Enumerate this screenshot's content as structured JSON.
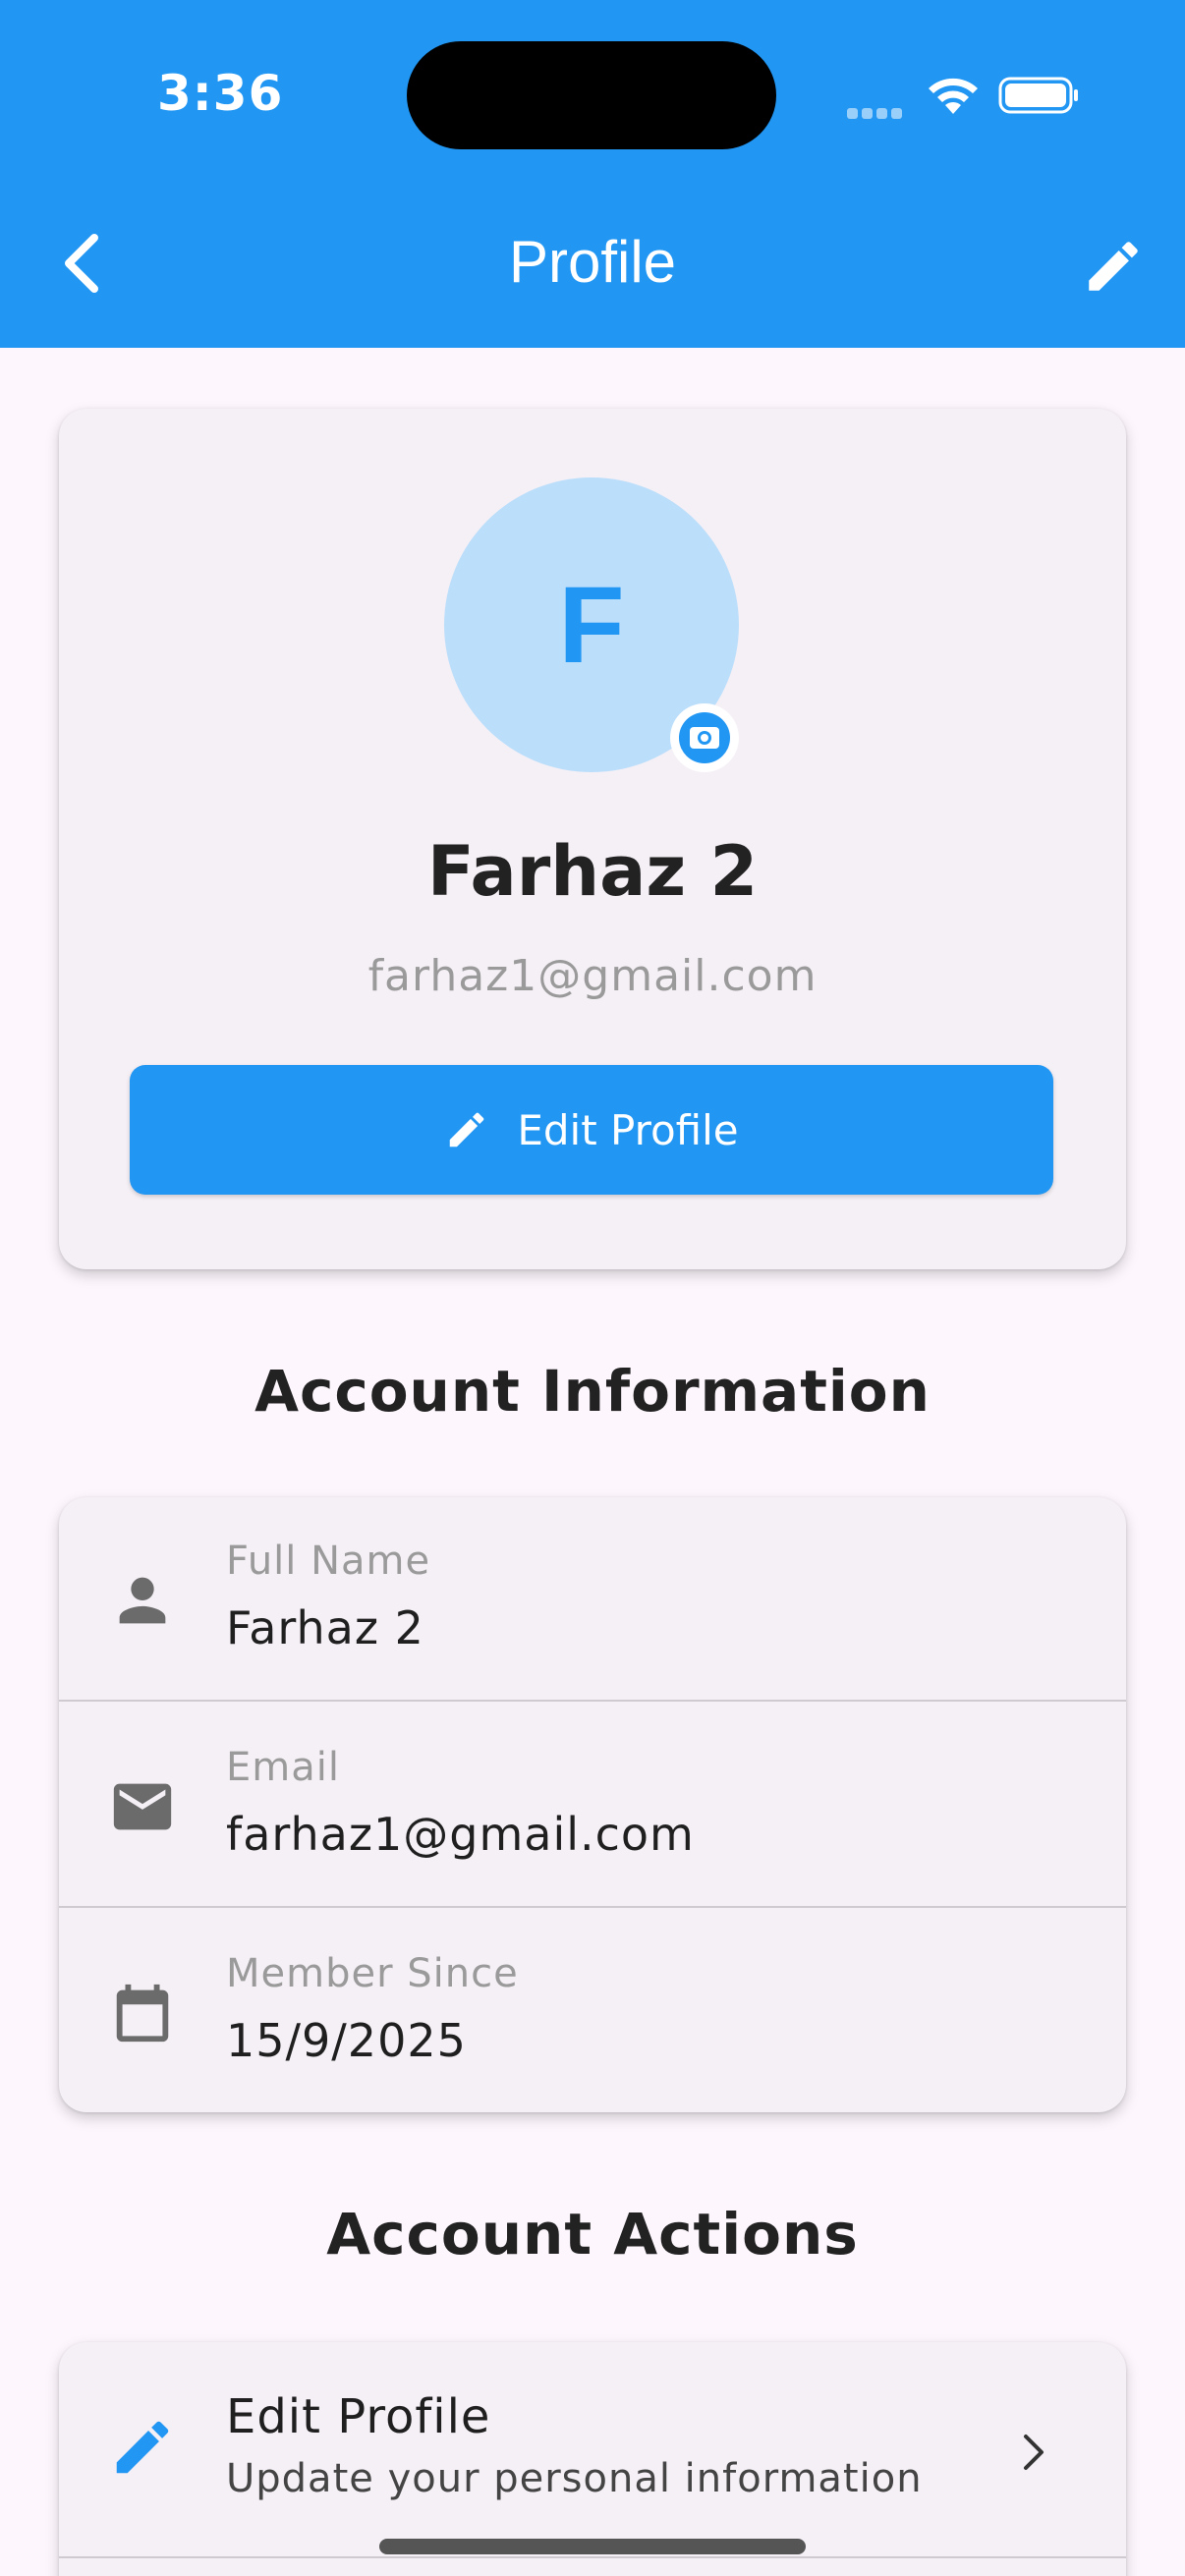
{
  "status_bar": {
    "time": "3:36"
  },
  "app_bar": {
    "title": "Profile"
  },
  "profile": {
    "avatar_initial": "F",
    "name": "Farhaz 2",
    "email": "farhaz1@gmail.com",
    "edit_button_label": "Edit Profile"
  },
  "account_information": {
    "title": "Account Information",
    "rows": [
      {
        "label": "Full Name",
        "value": "Farhaz 2",
        "icon": "person-icon"
      },
      {
        "label": "Email",
        "value": "farhaz1@gmail.com",
        "icon": "email-icon"
      },
      {
        "label": "Member Since",
        "value": "15/9/2025",
        "icon": "calendar-icon"
      }
    ]
  },
  "account_actions": {
    "title": "Account Actions",
    "items": [
      {
        "title": "Edit Profile",
        "subtitle": "Update your personal information",
        "icon": "pencil-icon"
      }
    ]
  },
  "colors": {
    "primary": "#2196f3",
    "avatar_bg": "#bbdefb",
    "card_bg": "#f5f0f6",
    "page_bg": "#fdf7fd"
  }
}
